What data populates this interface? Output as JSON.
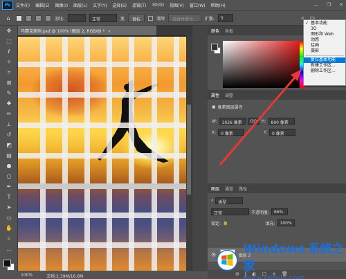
{
  "app": {
    "logo_text": "Ps",
    "menu": [
      "文件(F)",
      "编辑(E)",
      "图像(I)",
      "图层(L)",
      "文字(Y)",
      "选择(S)",
      "滤镜(T)",
      "3D(D)",
      "视图(V)",
      "窗口(W)",
      "帮助(H)"
    ],
    "window_controls": [
      "—",
      "❐",
      "✕"
    ]
  },
  "options_bar": {
    "feather_label": "羽化:",
    "mode_value": "正常",
    "width_label": "宽",
    "height_label": "高度",
    "btn_select": "选择并遮住...",
    "btn_flip": "目标",
    "clear_label": "清除",
    "expand_label": "扩散:",
    "expand_value": "5"
  },
  "tools": [
    "move",
    "marquee",
    "lasso",
    "magic-wand",
    "crop",
    "frame",
    "eyedropper",
    "heal",
    "brush",
    "stamp",
    "history-brush",
    "eraser",
    "gradient",
    "blur",
    "dodge",
    "pen",
    "type",
    "path-select",
    "shape",
    "hand",
    "zoom",
    "more"
  ],
  "document": {
    "tab_title": "马赛克案例.psd @ 100% (图层 2, RGB/8) *",
    "close_glyph": "×",
    "zoom": "100%",
    "doc_size": "文档:2.39M/16.6M"
  },
  "color_panel": {
    "tabs": [
      "颜色",
      "色板"
    ]
  },
  "properties_panel": {
    "tabs": [
      "属性",
      "调整"
    ],
    "section_title": "像素图层属性",
    "w_label": "W:",
    "w_value": "1026 像素",
    "link_label": "GO",
    "h_label": "H:",
    "h_value": "800 像素",
    "x_label": "X:",
    "x_value": "0 像素",
    "y_label": "Y:",
    "y_value": "0 像素"
  },
  "layers_panel": {
    "tabs": [
      "图层",
      "通道",
      "路径"
    ],
    "filter_label": "类型",
    "blend_mode": "正常",
    "opacity_label": "不透明度:",
    "opacity_value": "66%",
    "lock_label": "锁定:",
    "fill_label": "填充:",
    "fill_value": "100%",
    "layer_name": "图层 2"
  },
  "workspace_menu": {
    "items": [
      {
        "label": "基本功能",
        "checked": true
      },
      {
        "label": "3D",
        "checked": false
      },
      {
        "label": "图形和 Web",
        "checked": false
      },
      {
        "label": "动感",
        "checked": false
      },
      {
        "label": "绘画",
        "checked": false
      },
      {
        "label": "摄影",
        "checked": false
      }
    ],
    "reset": "复位基本功能",
    "new_ws": "新建工作区...",
    "delete_ws": "删除工作区..."
  },
  "watermark": {
    "title": "Windows",
    "cn": "系统之家",
    "url": "www.bjjmlv.com"
  },
  "colors": {
    "accent": "#0078d7",
    "arrow": "#e53935",
    "watermark": "#1c6fd8"
  }
}
